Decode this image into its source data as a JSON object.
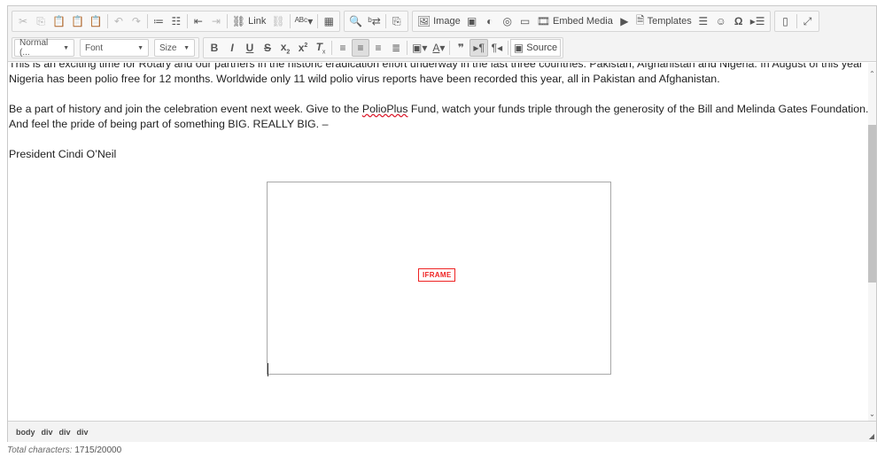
{
  "toolbar": {
    "link_label": "Link",
    "image_label": "Image",
    "embed_media_label": "Embed Media",
    "templates_label": "Templates",
    "format_value": "Normal (...",
    "font_value": "Font",
    "size_value": "Size",
    "source_label": "Source"
  },
  "content": {
    "para1": "This is an exciting time for Rotary and our partners in the historic eradication effort underway in the last three countries:  Pakistan, Afghanistan and Nigeria.  In August of this year Nigeria has been polio free for 12 months.  Worldwide only 11 wild polio virus reports have been recorded this year, all in Pakistan and Afghanistan.",
    "para2_before": "Be a part of history and join the celebration event next week.  Give to the ",
    "para2_link": "PolioPlus",
    "para2_after": " Fund, watch your funds triple through the generosity of the Bill and Melinda Gates Foundation.  And feel the pride of being part of something BIG.  REALLY BIG. –",
    "signature": "President Cindi O’Neil",
    "iframe_label": "IFRAME"
  },
  "statusbar": {
    "path": [
      "body",
      "div",
      "div",
      "div"
    ]
  },
  "counter": {
    "label": "Total characters:",
    "value": "1715/20000"
  },
  "colors": {
    "toolbar_bg": "#f3f3f3",
    "iframe_accent": "#e22222"
  }
}
